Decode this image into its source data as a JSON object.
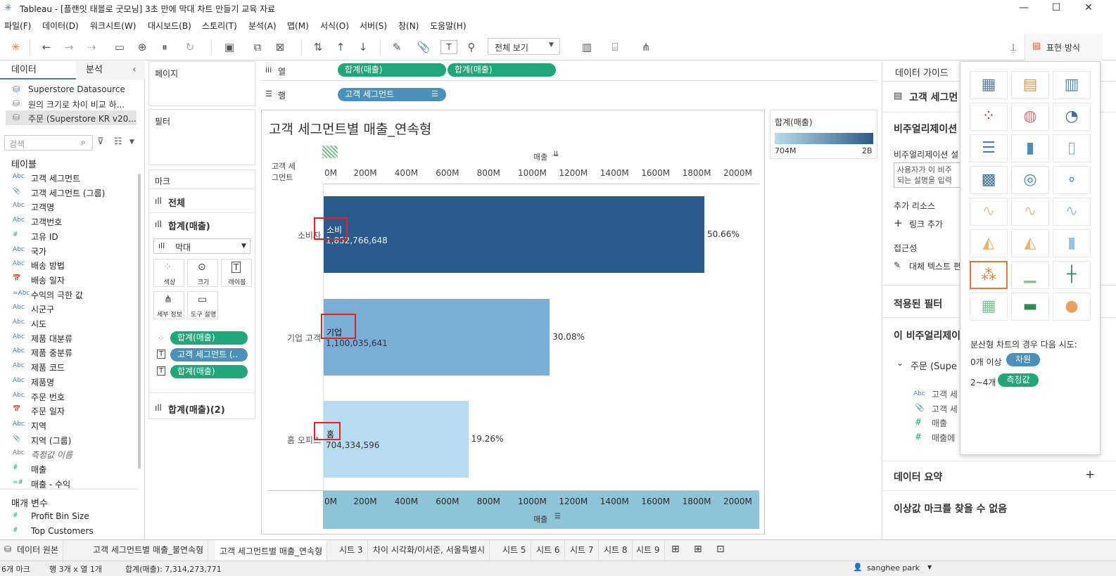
{
  "window": {
    "title": "Tableau - [플랜잇 태블로 굿모닝] 3초 만에 막대 차트 만들기 교육 자료",
    "min": "—",
    "max": "☐",
    "close": "✕"
  },
  "menu": [
    "파일(F)",
    "데이터(D)",
    "워크시트(W)",
    "대시보드(B)",
    "스토리(T)",
    "분석(A)",
    "맵(M)",
    "서식(O)",
    "서버(S)",
    "창(N)",
    "도움말(H)"
  ],
  "toolbar": {
    "view_select": "전체 보기",
    "showme_label": "표현 방식"
  },
  "left": {
    "tab_data": "데이터",
    "tab_analysis": "분석",
    "sources": [
      "Superstore Datasource",
      "원의 크기로 차이 비교 하...",
      "주문 (Superstore KR v20..."
    ],
    "search_placeholder": "검색",
    "tables_title": "테이블",
    "fields": [
      {
        "icon": "Abc",
        "name": "고객 세그먼트"
      },
      {
        "icon": "📎",
        "name": "고객 세그먼트 (그룹)"
      },
      {
        "icon": "Abc",
        "name": "고객명"
      },
      {
        "icon": "Abc",
        "name": "고객번호"
      },
      {
        "icon": "#",
        "name": "고유 ID"
      },
      {
        "icon": "Abc",
        "name": "국가"
      },
      {
        "icon": "Abc",
        "name": "배송 방법"
      },
      {
        "icon": "📅",
        "name": "배송 일자"
      },
      {
        "icon": "=Abc",
        "name": "수익의 극한 값"
      },
      {
        "icon": "Abc",
        "name": "시군구"
      },
      {
        "icon": "Abc",
        "name": "시도"
      },
      {
        "icon": "Abc",
        "name": "제품 대분류"
      },
      {
        "icon": "Abc",
        "name": "제품 중분류"
      },
      {
        "icon": "Abc",
        "name": "제품 코드"
      },
      {
        "icon": "Abc",
        "name": "제품명"
      },
      {
        "icon": "Abc",
        "name": "주문 번호"
      },
      {
        "icon": "📅",
        "name": "주문 일자"
      },
      {
        "icon": "Abc",
        "name": "지역"
      },
      {
        "icon": "📎",
        "name": "지역 (그룹)"
      },
      {
        "icon": "Abc",
        "name": "측정값 이름"
      },
      {
        "icon": "#",
        "name": "매출"
      },
      {
        "icon": "=#",
        "name": "매출 - 수익"
      }
    ],
    "params_title": "매개 변수",
    "params": [
      "Profit Bin Size",
      "Top Customers"
    ]
  },
  "shelves": {
    "pages": "페이지",
    "filters": "필터",
    "marks": "마크",
    "all": "전체",
    "measure": "합계(매출)",
    "marktype": "막대",
    "btn_color": "색상",
    "btn_size": "크기",
    "btn_label": "레이블",
    "btn_detail": "세부 정보",
    "btn_tooltip": "도구 설명",
    "mark_pills": [
      "합계(매출)",
      "고객 세그먼트 (..",
      "합계(매출)"
    ],
    "measure2": "합계(매출)(2)"
  },
  "columns": {
    "label": "열",
    "pills": [
      "합계(매출)",
      "합계(매출)"
    ]
  },
  "rows": {
    "label": "행",
    "pills": [
      "고객 세그먼트"
    ]
  },
  "viz": {
    "title": "고객 세그먼트별 매출_연속형",
    "row_header": "고객 세\n그먼트",
    "axis_title": "매출",
    "ticks": [
      "0M",
      "200M",
      "400M",
      "600M",
      "800M",
      "1000M",
      "1200M",
      "1400M",
      "1600M",
      "1800M",
      "2000M"
    ]
  },
  "chart_data": {
    "type": "bar",
    "orientation": "horizontal",
    "xlabel": "매출",
    "xlim": [
      0,
      2000000000
    ],
    "categories": [
      "소비자",
      "기업 고객",
      "홈 오피스"
    ],
    "values": [
      1852766648,
      1100035641,
      704334596
    ],
    "value_labels": [
      "1,852,766,648",
      "1,100,035,641",
      "704,334,596"
    ],
    "inner_labels": [
      "소비",
      "기업",
      "홈"
    ],
    "pct_labels": [
      "50.66%",
      "30.08%",
      "19.26%"
    ],
    "row_labels": [
      "소비자",
      "기업 고객",
      "홈 오피스"
    ],
    "colors": [
      "#2b5a8c",
      "#7aaed4",
      "#b7dcef"
    ]
  },
  "legend": {
    "title": "합계(매출)",
    "min": "704M",
    "max": "2B"
  },
  "guide": {
    "title": "데이터 가이드",
    "field": "고객 세그먼",
    "viz_head": "비주얼리제이션",
    "viz_desc": "비주얼리제이션 설",
    "desc_box": "사용자가 이 비주\n되는 설명을 입력",
    "more_res": "추가 리소스",
    "add_link": "링크 추가",
    "access": "접근성",
    "alt_text": "대체 텍스트 편",
    "applied_filters": "적용된 필터",
    "this_viz": "이 비주얼리제이",
    "orders": "주문 (Supe",
    "f1": "고객 세",
    "f2": "고객 세",
    "f3": "매출",
    "f4": "매출에 ",
    "summary": "데이터 요약",
    "outliers": "이상값 마크를 찾을 수 없음"
  },
  "showme": {
    "hint": "분산형 차트의 경우 다음 시도:",
    "req1": "0개 이상",
    "req1_pill": "차원",
    "req2": "2~4개",
    "req2_pill": "측정값"
  },
  "tabs": [
    "데이터 원본",
    "고객 세그먼트별 매출_불연속형",
    "고객 세그먼트별 매출_연속형",
    "시트 3",
    "차이 시각화/이서준, 서울특별시",
    "시트 5",
    "시트 6",
    "시트 7",
    "시트 8",
    "시트 9"
  ],
  "status": {
    "marks": "6개 마크",
    "rows": "행 3개 x 열 1개",
    "sum": "합계(매출): 7,314,273,771",
    "user": "sanghee park"
  }
}
